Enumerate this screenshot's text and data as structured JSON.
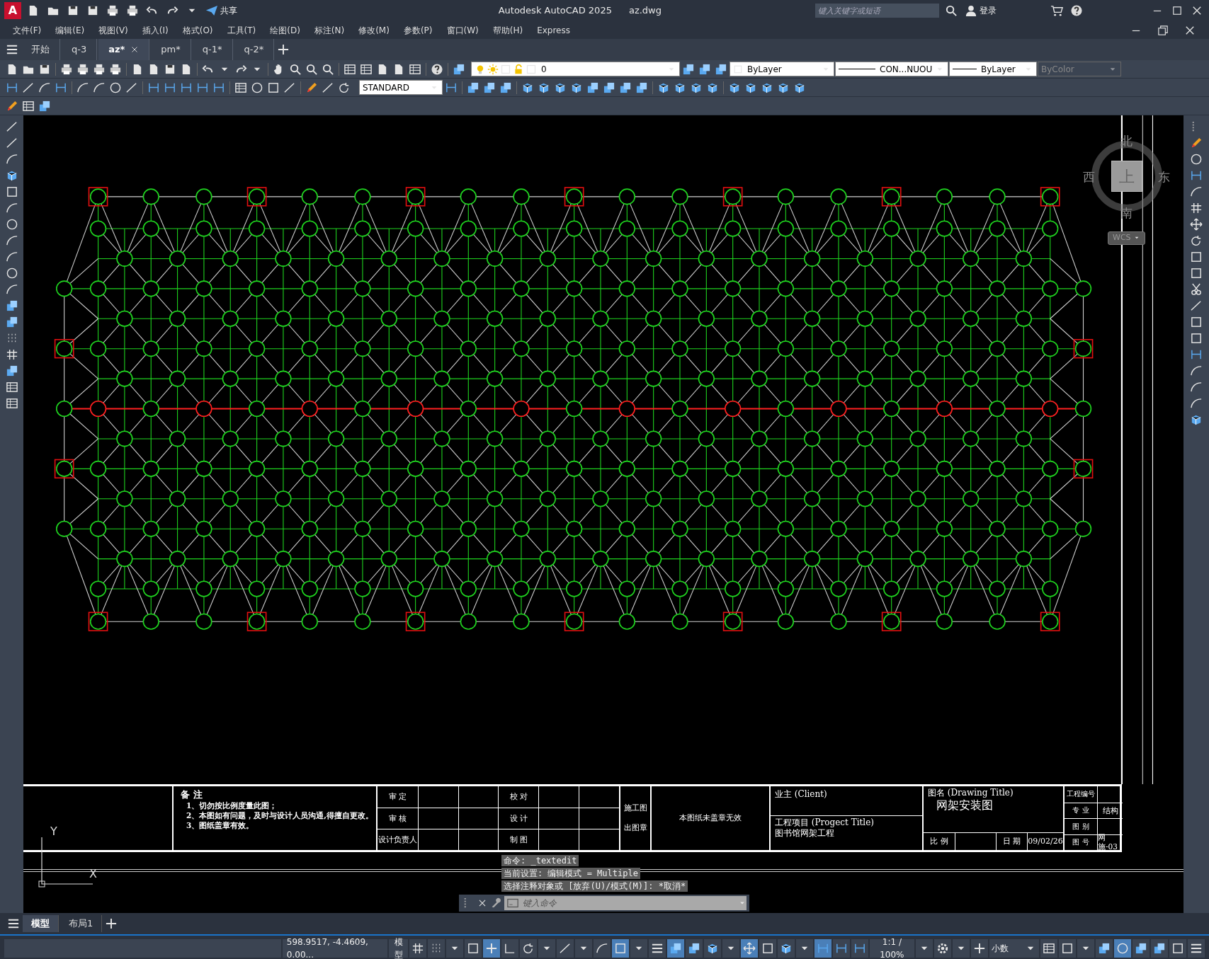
{
  "title_bar": {
    "app_logo": "A",
    "share": "共享",
    "title": "Autodesk AutoCAD 2025",
    "file": "az.dwg",
    "search": {
      "placeholder": "键入关键字或短语"
    },
    "login": "登录"
  },
  "menu": [
    "文件(F)",
    "编辑(E)",
    "视图(V)",
    "插入(I)",
    "格式(O)",
    "工具(T)",
    "绘图(D)",
    "标注(N)",
    "修改(M)",
    "参数(P)",
    "窗口(W)",
    "帮助(H)",
    "Express"
  ],
  "doc_tabs": [
    {
      "label": "开始",
      "selected": false,
      "closable": false
    },
    {
      "label": "q-3",
      "selected": false,
      "closable": false
    },
    {
      "label": "az*",
      "selected": true,
      "closable": true
    },
    {
      "label": "pm*",
      "selected": false,
      "closable": false
    },
    {
      "label": "q-1*",
      "selected": false,
      "closable": false
    },
    {
      "label": "q-2*",
      "selected": false,
      "closable": false
    }
  ],
  "toolbar": {
    "layer": "0",
    "color_control": "ByLayer",
    "linetype": "CON...NUOU",
    "lineweight": "ByLayer",
    "plot_style": {
      "value": "ByColor",
      "disabled": true
    },
    "text_style": "STANDARD"
  },
  "viewcube": {
    "north": "北",
    "south": "南",
    "west": "西",
    "east": "东",
    "face": "上",
    "ucs_menu": "WCS"
  },
  "title_block": {
    "notes_heading": "备 注",
    "notes": [
      "1、切勿按比例度量此图；",
      "2、本图如有问题，及时与设计人员沟通,得擅自更改。",
      "3、图纸盖章有效。"
    ],
    "signoff": [
      {
        "left": "审 定",
        "right": "校 对"
      },
      {
        "left": "审 核",
        "right": "设 计"
      },
      {
        "left": "设计负责人",
        "right": "制 图"
      }
    ],
    "seal": [
      "施工图",
      "出图章"
    ],
    "stamp_note": "本图纸未盖章无效",
    "client_label": "业主 (Client)",
    "project_label": "工程项目 (Progect Title)",
    "project": "图书馆网架工程",
    "drawing_title_label": "图名 (Drawing Title)",
    "drawing_title": "网架安装图",
    "scale_label": "比 例",
    "date_label": "日 期",
    "date": "09/02/26",
    "info": [
      {
        "label": "工程编号"
      },
      {
        "label": "专 业",
        "value": "结构"
      },
      {
        "label": "图 别"
      },
      {
        "label": "图 号",
        "value": "网施-03"
      }
    ]
  },
  "ucs": {
    "y": "Y",
    "x": "X"
  },
  "command_history": [
    "命令: _textedit",
    "当前设置: 编辑模式 = Multiple",
    "选择注释对象或 [放弃(U)/模式(M)]: *取消*"
  ],
  "command_line": {
    "placeholder": "键入命令"
  },
  "layout_tabs": [
    {
      "label": "模型",
      "selected": true
    },
    {
      "label": "布局1",
      "selected": false
    }
  ],
  "status_bar": {
    "coordinates": "598.9517, -4.4609, 0.00...",
    "space": "模型",
    "scale": "1:1 / 100%",
    "units": "小数"
  }
}
